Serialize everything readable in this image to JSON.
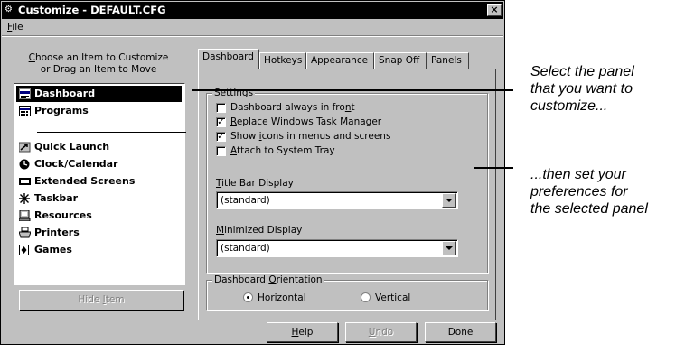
{
  "window": {
    "title": "Customize - DEFAULT.CFG",
    "close_glyph": "×"
  },
  "menu": {
    "file": "File"
  },
  "left": {
    "caption_line1": "Choose an Item to Customize",
    "caption_line2": "or Drag an Item to Move",
    "items": [
      {
        "label": "Dashboard",
        "icon": "dashboard-icon",
        "selected": true
      },
      {
        "label": "Programs",
        "icon": "programs-icon"
      },
      {
        "label": "Quick Launch",
        "icon": "quick-launch-icon"
      },
      {
        "label": "Clock/Calendar",
        "icon": "clock-icon"
      },
      {
        "label": "Extended Screens",
        "icon": "extended-screens-icon"
      },
      {
        "label": "Taskbar",
        "icon": "taskbar-icon"
      },
      {
        "label": "Resources",
        "icon": "resources-icon"
      },
      {
        "label": "Printers",
        "icon": "printers-icon"
      },
      {
        "label": "Games",
        "icon": "games-icon"
      }
    ],
    "hide_button": "Hide Item"
  },
  "tabs": [
    "Dashboard",
    "Hotkeys",
    "Appearance",
    "Snap Off",
    "Panels"
  ],
  "settings": {
    "group_title": "Settings",
    "checks": [
      {
        "label": "Dashboard always in front",
        "checked": false
      },
      {
        "label": "Replace Windows Task Manager",
        "checked": true
      },
      {
        "label": "Show icons in menus and screens",
        "checked": true
      },
      {
        "label": "Attach to System Tray",
        "checked": false
      }
    ],
    "title_bar_label": "Title Bar Display",
    "title_bar_value": "(standard)",
    "minimized_label": "Minimized Display",
    "minimized_value": "(standard)"
  },
  "orientation": {
    "group_title": "Dashboard Orientation",
    "horizontal": "Horizontal",
    "vertical": "Vertical",
    "selected": "Horizontal"
  },
  "buttons": {
    "help": "Help",
    "undo": "Undo",
    "done": "Done"
  },
  "callouts": {
    "first": [
      "Select the panel",
      "that you want to",
      "customize..."
    ],
    "second": [
      "...then set your",
      "preferences for",
      "the selected panel"
    ]
  }
}
